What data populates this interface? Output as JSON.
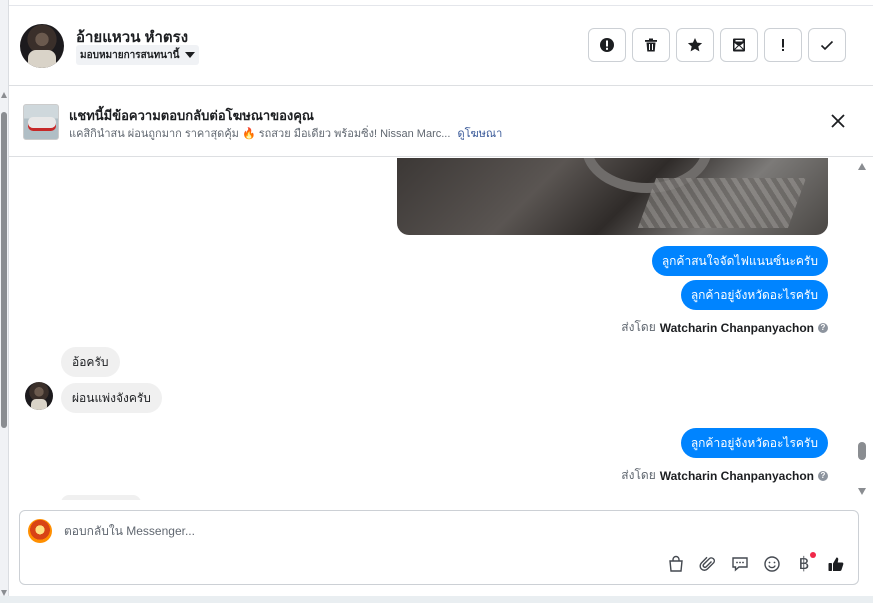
{
  "header": {
    "contact_name": "อ้ายแหวน หำตรง",
    "assign_label": "มอบหมายการสนทนานี้"
  },
  "actions": [
    {
      "name": "mark-spam-button",
      "icon": "alert-circle-icon"
    },
    {
      "name": "delete-button",
      "icon": "trash-icon"
    },
    {
      "name": "star-button",
      "icon": "star-icon"
    },
    {
      "name": "mark-unread-button",
      "icon": "envelope-icon"
    },
    {
      "name": "follow-up-button",
      "icon": "exclamation-icon"
    },
    {
      "name": "mark-done-button",
      "icon": "check-icon"
    }
  ],
  "ad_banner": {
    "title": "แชทนี้มีข้อความตอบกลับต่อโฆษณาของคุณ",
    "description": "แคสิกินำสน ผ่อนถูกมาก ราคาสุดคุ้ม 🔥 รถสวย มือเดียว พร้อมซิ่ง! Nissan Marc...",
    "link_label": "ดูโฆษณา"
  },
  "messages": {
    "out_1": "ลูกค้าสนใจจัดไฟแนนซ์นะครับ",
    "out_2": "ลูกค้าอยู่จังหวัดอะไรครับ",
    "sent_by_prefix_1": "ส่งโดย",
    "sent_by_name_1": "Watcharin Chanpanyachon",
    "in_1": "อ้อครับ",
    "in_2": "ผ่อนแพ่งจังครับ",
    "out_3": "ลูกค้าอยู่จังหวัดอะไรครับ",
    "sent_by_prefix_2": "ส่งโดย",
    "sent_by_name_2": "Watcharin Chanpanyachon"
  },
  "composer": {
    "placeholder": "ตอบกลับใน Messenger...",
    "tools": [
      "bag-icon",
      "paperclip-icon",
      "chat-bubble-icon",
      "smiley-icon",
      "baht-icon",
      "thumbs-up-icon"
    ],
    "baht_symbol": "฿"
  },
  "colors": {
    "accent": "#0084ff",
    "incoming_bubble": "#f0f0f0",
    "link": "#385898",
    "notification": "#f02849"
  }
}
